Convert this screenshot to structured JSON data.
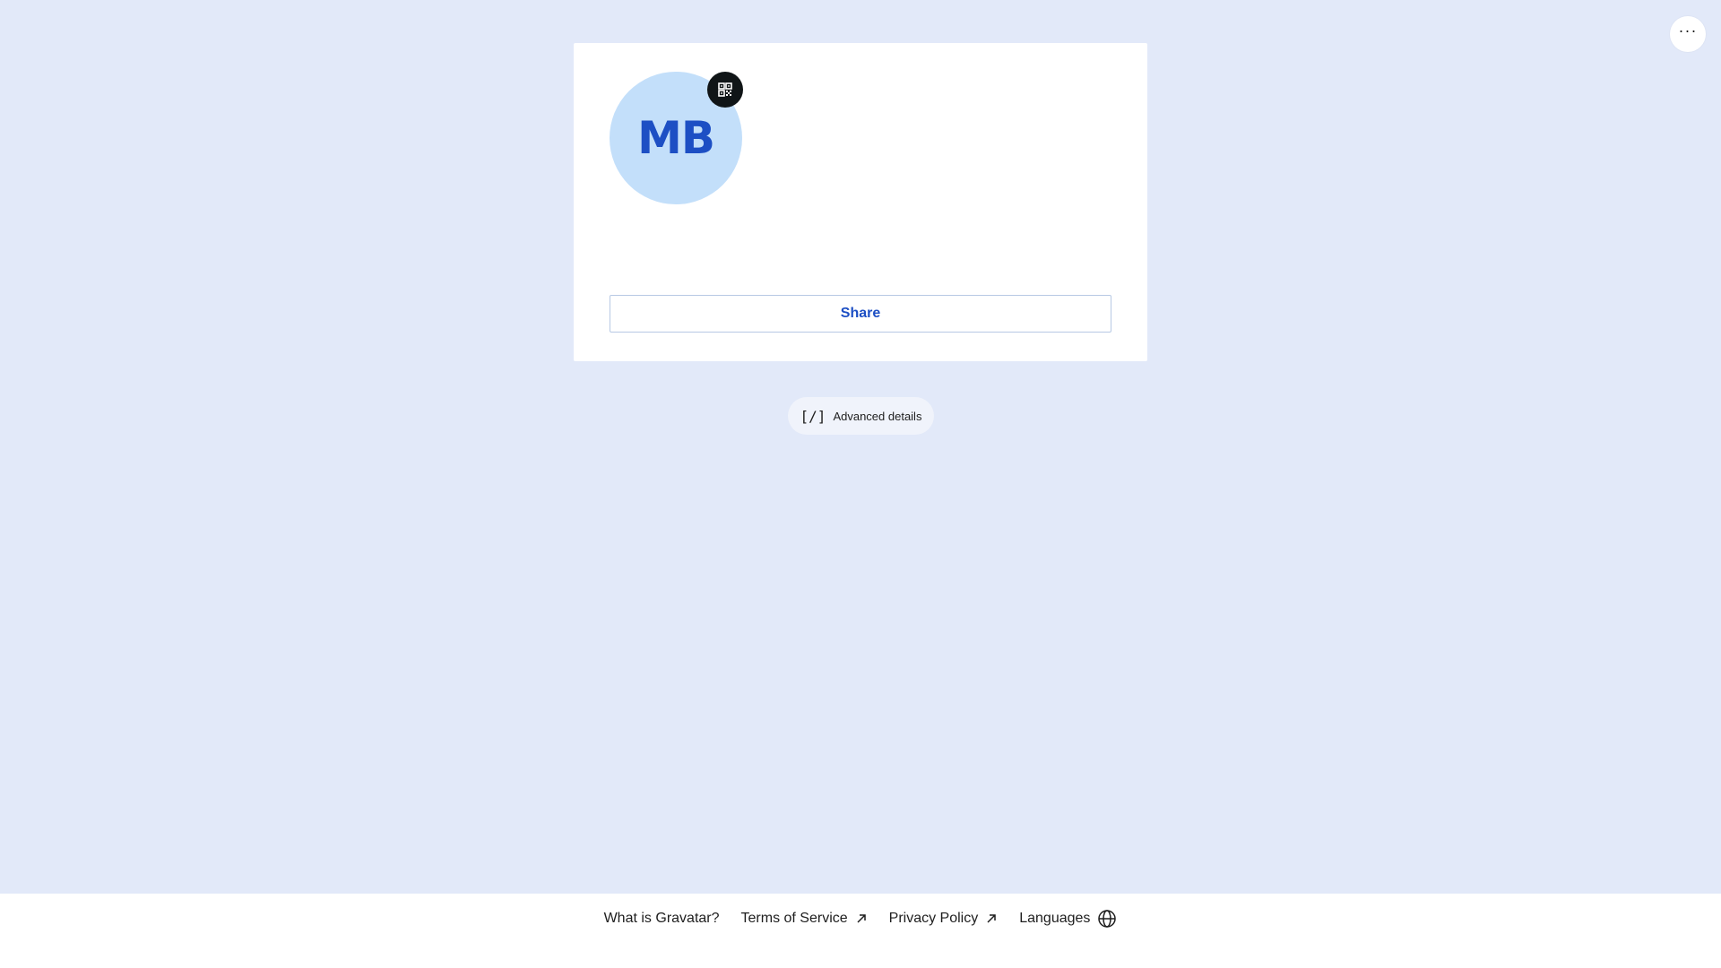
{
  "profile": {
    "initials": "MB"
  },
  "card": {
    "share_label": "Share"
  },
  "advanced": {
    "icon_text": "[/]",
    "label": "Advanced details"
  },
  "header": {
    "more_icon": "···"
  },
  "footer": {
    "links": [
      {
        "label": "What is Gravatar?",
        "icon": "none"
      },
      {
        "label": "Terms of Service",
        "icon": "arrow-up-right-icon"
      },
      {
        "label": "Privacy Policy",
        "icon": "arrow-up-right-icon"
      },
      {
        "label": "Languages",
        "icon": "globe-icon"
      }
    ]
  },
  "colors": {
    "background": "#e2e9f9",
    "accent": "#1d4fc4",
    "avatar_bg": "#c3dffa",
    "qr_badge": "#101517"
  }
}
